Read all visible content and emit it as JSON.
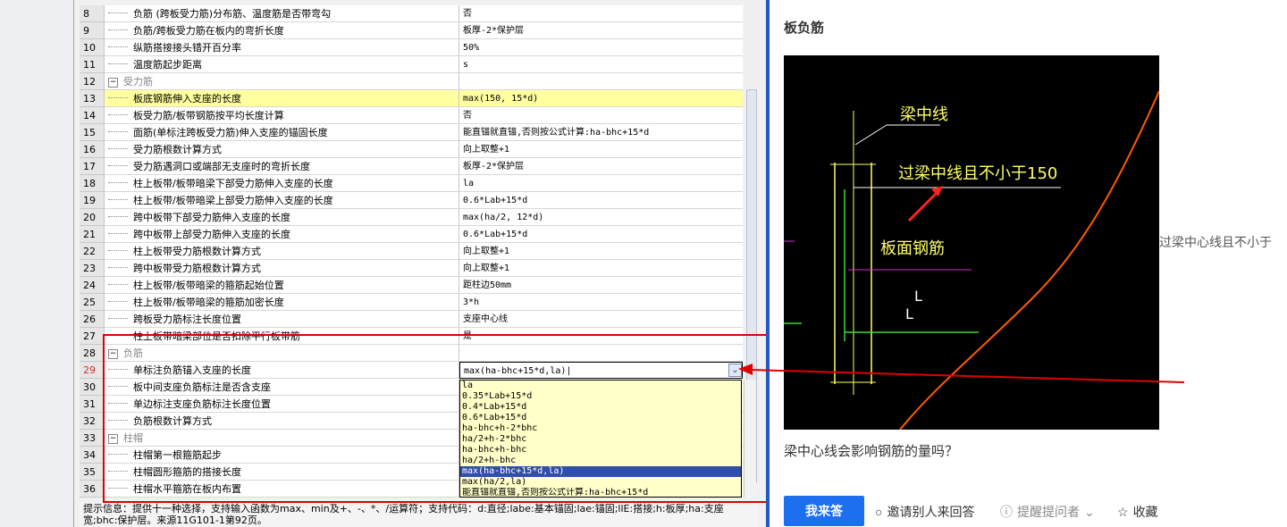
{
  "rows": [
    {
      "num": "8",
      "name": "负筋 (跨板受力筋)分布筋、温度筋是否带弯勾",
      "value": "否"
    },
    {
      "num": "9",
      "name": "负筋/跨板受力筋在板内的弯折长度",
      "value": "板厚-2*保护层"
    },
    {
      "num": "10",
      "name": "纵筋搭接接头错开百分率",
      "value": "50%"
    },
    {
      "num": "11",
      "name": "温度筋起步距离",
      "value": "s"
    },
    {
      "num": "12",
      "name": "受力筋",
      "value": "",
      "group": true
    },
    {
      "num": "13",
      "name": "板底钢筋伸入支座的长度",
      "value": "max(150, 15*d)",
      "yellow": true
    },
    {
      "num": "14",
      "name": "板受力筋/板带钢筋按平均长度计算",
      "value": "否"
    },
    {
      "num": "15",
      "name": "面筋(单标注跨板受力筋)伸入支座的锚固长度",
      "value": "能直锚就直锚,否则按公式计算:ha-bhc+15*d"
    },
    {
      "num": "16",
      "name": "受力筋根数计算方式",
      "value": "向上取整+1"
    },
    {
      "num": "17",
      "name": "受力筋遇洞口或端部无支座时的弯折长度",
      "value": "板厚-2*保护层"
    },
    {
      "num": "18",
      "name": "柱上板带/板带暗梁下部受力筋伸入支座的长度",
      "value": "la"
    },
    {
      "num": "19",
      "name": "柱上板带/板带暗梁上部受力筋伸入支座的长度",
      "value": "0.6*Lab+15*d"
    },
    {
      "num": "20",
      "name": "跨中板带下部受力筋伸入支座的长度",
      "value": "max(ha/2, 12*d)"
    },
    {
      "num": "21",
      "name": "跨中板带上部受力筋伸入支座的长度",
      "value": "0.6*Lab+15*d"
    },
    {
      "num": "22",
      "name": "柱上板带受力筋根数计算方式",
      "value": "向上取整+1"
    },
    {
      "num": "23",
      "name": "跨中板带受力筋根数计算方式",
      "value": "向上取整+1"
    },
    {
      "num": "24",
      "name": "柱上板带/板带暗梁的箍筋起始位置",
      "value": "距柱边50mm"
    },
    {
      "num": "25",
      "name": "柱上板带/板带暗梁的箍筋加密长度",
      "value": "3*h"
    },
    {
      "num": "26",
      "name": "跨板受力筋标注长度位置",
      "value": "支座中心线"
    },
    {
      "num": "27",
      "name": "柱上板带暗梁部位是否扣除平行板带筋",
      "value": "是"
    },
    {
      "num": "28",
      "name": "负筋",
      "value": "",
      "group": true
    },
    {
      "num": "29",
      "name": "单标注负筋锚入支座的长度",
      "value": "max(ha-bhc+15*d,la)|",
      "selected": true
    },
    {
      "num": "30",
      "name": "板中间支座负筋标注是否含支座",
      "value": ""
    },
    {
      "num": "31",
      "name": "单边标注支座负筋标注长度位置",
      "value": ""
    },
    {
      "num": "32",
      "name": "负筋根数计算方式",
      "value": ""
    },
    {
      "num": "33",
      "name": "柱帽",
      "value": "",
      "group": true
    },
    {
      "num": "34",
      "name": "柱帽第一根箍筋起步",
      "value": ""
    },
    {
      "num": "35",
      "name": "柱帽圆形箍筋的搭接长度",
      "value": ""
    },
    {
      "num": "36",
      "name": "柱帽水平箍筋在板内布置",
      "value": ""
    }
  ],
  "dropdown_options": [
    "la",
    "0.35*Lab+15*d",
    "0.4*Lab+15*d",
    "0.6*Lab+15*d",
    "ha-bhc+h-2*bhc",
    "ha/2+h-2*bhc",
    "ha-bhc+h-bhc",
    "ha/2+h-bhc",
    "max(ha-bhc+15*d,la)",
    "max(ha/2,la)",
    "能直锚就直锚,否则按公式计算:ha-bhc+15*d"
  ],
  "dropdown_selected_index": 8,
  "info_text": "提示信息：提供十一种选择，支持输入函数为max、min及+、-、*、/运算符；支持代码：d:直径;labe:基本锚固;lae:锚固;llE:搭接;h:板厚;ha:支座宽;bhc:保护层。来源11G101-1第92页。",
  "right_panel": {
    "title": "板负筋",
    "figure_labels": {
      "beam_center": "梁中线",
      "over_center": "过梁中线且不小于150",
      "top_bar": "板面钢筋",
      "l1": "L",
      "l2": "L"
    },
    "overflow_text": "过梁中心线且不小于",
    "question": "梁中心线会影响钢筋的量吗？",
    "answer_button": "我来答",
    "invite": "邀请别人来回答",
    "remind": "提醒提问者",
    "favorite": "收藏"
  },
  "colors": {
    "highlight_yellow": "#ffffa0",
    "selection_blue": "#2f4fa8",
    "annotation_red": "#e00000",
    "accent_blue": "#1e6ff0"
  }
}
